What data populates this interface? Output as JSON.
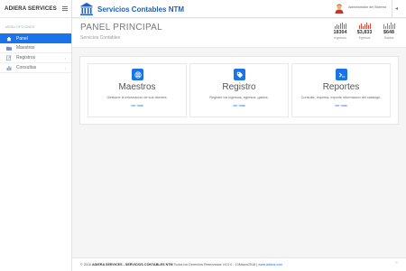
{
  "sidebar": {
    "brand": "ADIERA SERVICES",
    "menu_caption": "MENU OPCIONES",
    "items": [
      {
        "label": "Panel",
        "icon": "home-icon",
        "active": true
      },
      {
        "label": "Maestros",
        "icon": "folder-icon",
        "active": false
      },
      {
        "label": "Registros",
        "icon": "edit-icon",
        "active": false
      },
      {
        "label": "Consultas",
        "icon": "chart-icon",
        "active": false
      }
    ]
  },
  "header": {
    "title": "Servicios Contables NTM",
    "user": "Administrador del Sistema"
  },
  "page": {
    "title": "PANEL PRINCIPAL",
    "subtitle": "Servicios Contables"
  },
  "stats": [
    {
      "value": "18304",
      "label": "Ingresos",
      "color": "#3fa34d"
    },
    {
      "value": "$3,833",
      "label": "Egresos",
      "color": "#e04a3a"
    },
    {
      "value": "$648",
      "label": "Saldos",
      "color": "#7f8c8d"
    }
  ],
  "cards": [
    {
      "title": "Maestros",
      "description": "Gestione la informacion de sus clientes.",
      "link": "ver mas",
      "icon": "database-icon"
    },
    {
      "title": "Registro",
      "description": "Registre los ingresos, egresos, gastos.",
      "link": "ver mas",
      "icon": "tag-icon"
    },
    {
      "title": "Reportes",
      "description": "Consulte, imprima, exporte informacion del catalogo.",
      "link": "ver mas",
      "icon": "terminal-icon"
    }
  ],
  "footer": {
    "copyright": "© 2018",
    "brand": "ADIERA SERVICES - SERVICIOS CONTABLES NTM",
    "rights": "Todos los Derechos Reservados V4.0.0 - 13Marzo2018 |",
    "link": "www.adiera.com"
  },
  "colors": {
    "accent": "#1a73e8",
    "title_blue": "#1f5fb8"
  }
}
